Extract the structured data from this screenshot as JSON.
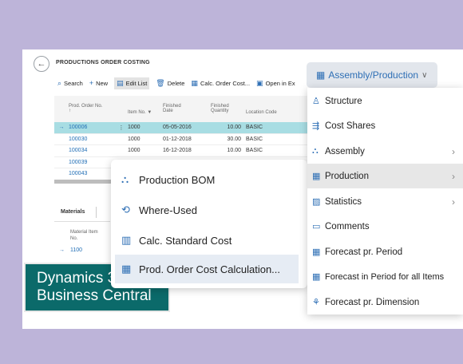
{
  "page": {
    "title": "PRODUCTIONS ORDER COSTING",
    "back_icon": "←"
  },
  "toolbar": {
    "search": "Search",
    "new": "New",
    "edit_list": "Edit List",
    "delete": "Delete",
    "calc_order_cost": "Calc. Order Cost...",
    "open_in": "Open in Ex"
  },
  "grid": {
    "headers": {
      "prod_order_no": "Prod. Order No.",
      "prod_order_arrow": "↑",
      "item_no": "Item No.",
      "finished_date_1": "Finished",
      "finished_date_2": "Date",
      "finished_qty_1": "Finished",
      "finished_qty_2": "Quantity",
      "location_code": "Location Code"
    },
    "rows": [
      {
        "arrow": "→",
        "no": "100006",
        "dots": "⋮",
        "item": "1000",
        "date": "05-05-2016",
        "qty": "10.00",
        "loc": "BASIC"
      },
      {
        "arrow": "",
        "no": "100030",
        "dots": "",
        "item": "1000",
        "date": "01-12-2018",
        "qty": "30.00",
        "loc": "BASIC"
      },
      {
        "arrow": "",
        "no": "100034",
        "dots": "",
        "item": "1000",
        "date": "16-12-2018",
        "qty": "10.00",
        "loc": "BASIC"
      },
      {
        "arrow": "",
        "no": "100039",
        "dots": "",
        "item": "",
        "date": "",
        "qty": "",
        "loc": ""
      },
      {
        "arrow": "",
        "no": "100043",
        "dots": "",
        "item": "",
        "date": "",
        "qty": "",
        "loc": ""
      }
    ]
  },
  "materials": {
    "tab": "Materials",
    "header_1": "Material Item",
    "header_2": "No.",
    "row_arrow": "→",
    "row_value": "1100"
  },
  "brand": {
    "line1": "Dynamics 365",
    "line2": "Business Central"
  },
  "submenu": {
    "items": [
      {
        "label": "Production BOM",
        "icon": "hierarchy-icon"
      },
      {
        "label": "Where-Used",
        "icon": "where-used-icon"
      },
      {
        "label": "Calc. Standard Cost",
        "icon": "calculate-icon"
      },
      {
        "label": "Prod. Order Cost Calculation...",
        "icon": "cost-calc-icon"
      }
    ]
  },
  "dropdown": {
    "label": "Assembly/Production",
    "chevron": "∨"
  },
  "mainmenu": {
    "items": [
      {
        "label": "Structure",
        "icon": "structure-icon",
        "submenu": false
      },
      {
        "label": "Cost Shares",
        "icon": "cost-shares-icon",
        "submenu": false
      },
      {
        "label": "Assembly",
        "icon": "assembly-icon",
        "submenu": true
      },
      {
        "label": "Production",
        "icon": "production-icon",
        "submenu": true
      },
      {
        "label": "Statistics",
        "icon": "statistics-icon",
        "submenu": true
      },
      {
        "label": "Comments",
        "icon": "comments-icon",
        "submenu": false
      },
      {
        "label": "Forecast pr. Period",
        "icon": "forecast-icon",
        "submenu": false
      },
      {
        "label": "Forecast in Period for all Items",
        "icon": "forecast-all-icon",
        "submenu": false
      },
      {
        "label": "Forecast pr. Dimension",
        "icon": "forecast-dimension-icon",
        "submenu": false
      }
    ],
    "arrow": "›"
  },
  "colors": {
    "background": "#bdb4d9",
    "accent": "#2e6fb5",
    "selected_row": "#a8dde3",
    "brand": "#0b6a6a"
  }
}
